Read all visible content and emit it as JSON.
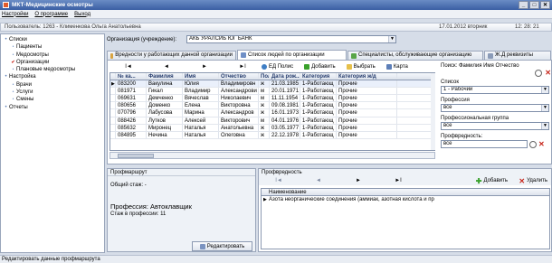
{
  "window": {
    "title": "МКТ-Медицинские осмотры",
    "min": "_",
    "max": "□",
    "close": "✕"
  },
  "menu": {
    "items": [
      "Настройки",
      "О программе",
      "Выход"
    ]
  },
  "userbar": {
    "user": "Пользователь: 1263 - Клименкова Ольга Анатольевна",
    "date": "17.01.2012 вторник",
    "time": "12: 28: 21"
  },
  "sidebar": {
    "items": [
      {
        "label": "Списки",
        "level": 1,
        "marker": "•"
      },
      {
        "label": "Пациенты",
        "level": 2,
        "marker": "•"
      },
      {
        "label": "Медосмотры",
        "level": 2,
        "marker": "•"
      },
      {
        "label": "Организации",
        "level": 2,
        "marker": "✔"
      },
      {
        "label": "Плановые медосмотры",
        "level": 2,
        "marker": "•"
      },
      {
        "label": "Настройка",
        "level": 1,
        "marker": "•"
      },
      {
        "label": "Врачи",
        "level": 2,
        "marker": "•"
      },
      {
        "label": "Услуги",
        "level": 2,
        "marker": "•"
      },
      {
        "label": "Смены",
        "level": 2,
        "marker": "•"
      },
      {
        "label": "Отчеты",
        "level": 1,
        "marker": "•"
      }
    ]
  },
  "org": {
    "label": "Организация (учреждение):",
    "value": "АКБ УРАЛСИБ ЮГ БАНК"
  },
  "tabs": [
    "Вредности у работающих данной организации",
    "Список людей по организации",
    "Специалисты, обслуживающие организацию",
    "Ж.Д реквизиты"
  ],
  "nav": {
    "first": "I◄",
    "prev": "◄",
    "next": "►",
    "last": "►I"
  },
  "actions": {
    "policy": "ЕД Полис",
    "add": "Добавить",
    "select": "Выбрать",
    "card": "Карта"
  },
  "grid": {
    "headers": [
      "",
      "№ ка...",
      "Фамилия",
      "Имя",
      "Отчество",
      "Пол",
      "Дата рож...",
      "Категория",
      "Категория ж/д"
    ],
    "rows": [
      [
        "▶",
        "083200",
        "Вакулина",
        "Юлия",
        "Владимировн",
        "ж",
        "21.03.1985",
        "1-Работающ",
        "Прочие"
      ],
      [
        "",
        "081971",
        "Гикал",
        "Владимир",
        "Александрови",
        "м",
        "20.01.1971",
        "1-Работающ",
        "Прочие"
      ],
      [
        "",
        "069631",
        "Демченко",
        "Вячеслав",
        "Николаевич",
        "м",
        "11.11.1954",
        "1-Работающ",
        "Прочие"
      ],
      [
        "",
        "080656",
        "Доменко",
        "Елена",
        "Викторовна",
        "ж",
        "09.08.1981",
        "1-Работающ",
        "Прочие"
      ],
      [
        "",
        "070796",
        "Лабусова",
        "Марина",
        "Александров",
        "ж",
        "16.01.1973",
        "1-Работающ",
        "Прочие"
      ],
      [
        "",
        "088426",
        "Лутков",
        "Алексей",
        "Викторович",
        "м",
        "04.01.1976",
        "1-Работающ",
        "Прочие"
      ],
      [
        "",
        "085632",
        "Миронец",
        "Наталья",
        "Анатольевна",
        "ж",
        "03.05.1977",
        "1-Работающ",
        "Прочие"
      ],
      [
        "",
        "084895",
        "Нечина",
        "Наталья",
        "Олеговна",
        "ж",
        "22.12.1978",
        "1-Работающ",
        "Прочие"
      ]
    ]
  },
  "filters": {
    "search_label": "Поиск: Фамилия Имя Отчество",
    "list_label": "Список",
    "list_value": "1 - Рабочий",
    "profession_label": "Профессия",
    "profession_value": "все",
    "prof_group_label": "Профессиональная группа",
    "prof_group_value": "все",
    "hazard_label": "Профвредность:",
    "hazard_value": "все"
  },
  "profroute": {
    "title": "Профмаршрут",
    "total_exp": "Общий стаж: -",
    "profession": "Профессия: Автоклавщик",
    "prof_exp": "Стаж в профессии: 11",
    "edit_btn": "Редактировать"
  },
  "hazards": {
    "title": "Профвредность",
    "add": "Добавить",
    "delete": "Удалить",
    "column": "Наименование",
    "rows": [
      "Азота неорганические соединения (аммиак, азотная кислота и пр"
    ]
  },
  "status": "Редактировать данные профмаршрута",
  "colors": {
    "accent": "#3b5fa3",
    "header_text": "#233a6b",
    "delete_red": "#c7261b",
    "add_green": "#3aa12c"
  }
}
